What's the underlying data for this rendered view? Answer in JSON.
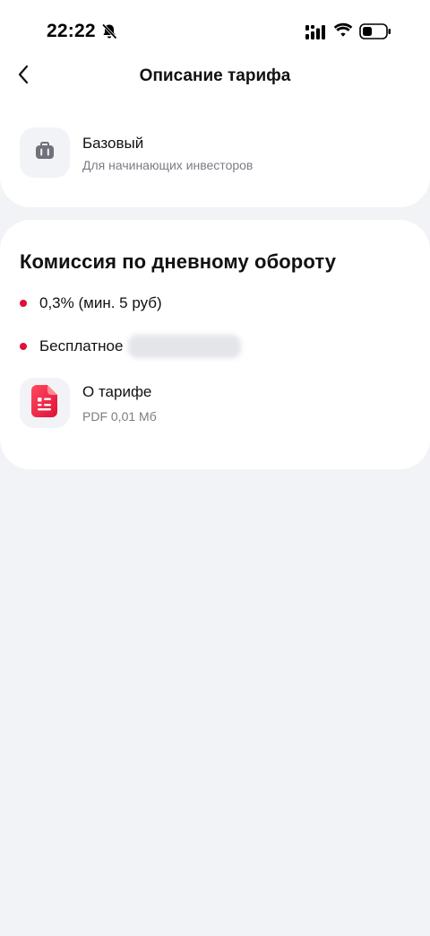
{
  "status_bar": {
    "time": "22:22"
  },
  "icons": {
    "bell": "bell-slash-icon",
    "signal": "cellular-signal-icon",
    "wifi": "wifi-icon",
    "battery": "battery-icon",
    "back": "chevron-left-icon",
    "tariff": "briefcase-icon",
    "document": "pdf-document-icon"
  },
  "header": {
    "title": "Описание тарифа"
  },
  "tariff": {
    "name": "Базовый",
    "description": "Для начинающих инвесторов"
  },
  "commission": {
    "title": "Комиссия по дневному обороту",
    "items": [
      {
        "text": "0,3% (мин. 5 руб)"
      },
      {
        "text": "Бесплатное"
      }
    ]
  },
  "document": {
    "name": "О тарифе",
    "meta": "PDF 0,01 Мб"
  },
  "colors": {
    "background": "#f2f3f6",
    "card": "#ffffff",
    "accent": "#e0103a",
    "secondary_text": "#7a7d85"
  }
}
